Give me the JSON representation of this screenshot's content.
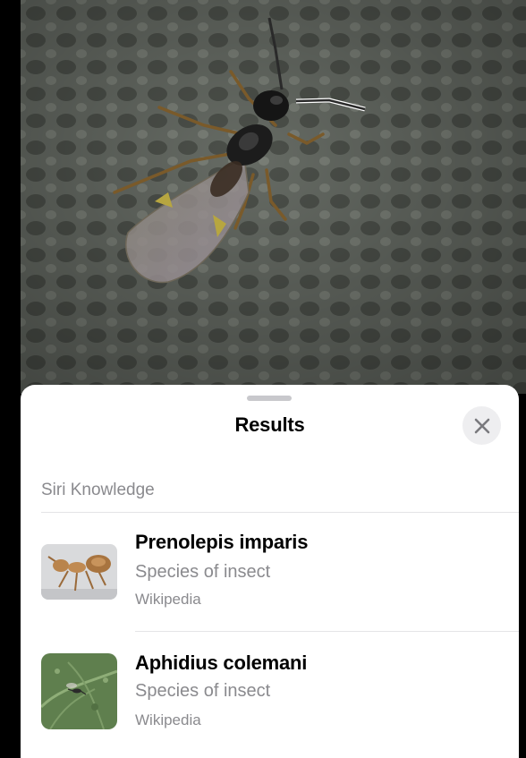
{
  "sheet": {
    "title": "Results"
  },
  "section": {
    "header": "Siri Knowledge"
  },
  "results": [
    {
      "title": "Prenolepis imparis",
      "subtitle": "Species of insect",
      "source": "Wikipedia",
      "thumbnail_icon": "ant-thumbnail"
    },
    {
      "title": "Aphidius colemani",
      "subtitle": "Species of insect",
      "source": "Wikipedia",
      "thumbnail_icon": "wasp-on-leaf-thumbnail"
    }
  ],
  "colors": {
    "sheet_background": "#ffffff",
    "secondary_text": "#8a8a8e",
    "close_button_background": "#eeeef0",
    "grabber": "#c8c8cc"
  }
}
